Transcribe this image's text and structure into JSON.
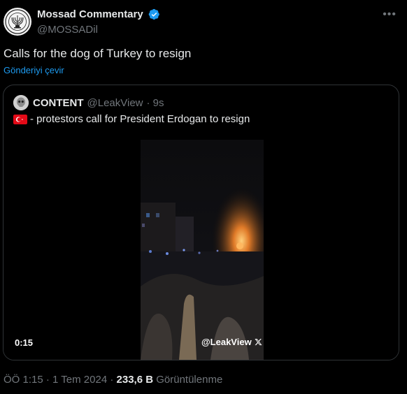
{
  "tweet": {
    "display_name": "Mossad Commentary",
    "handle": "@MOSSADil",
    "more_icon": "•••",
    "text": "Calls for the dog of Turkey to resign",
    "translate_link": "Gönderiyi çevir",
    "verified_color": "#1d9bf0"
  },
  "quote": {
    "display_name": "CONTENT",
    "handle": "@LeakView",
    "age": "· 9s",
    "flag_icon": "turkey-flag-icon",
    "text": "- protestors call for President Erdogan to resign",
    "video": {
      "duration": "0:15",
      "watermark": "@LeakView"
    }
  },
  "meta": {
    "time": "ÖÖ 1:15",
    "dot1": " · ",
    "date": "1 Tem 2024",
    "dot2": " · ",
    "views_count": "233,6 B",
    "views_label": " Görüntülenme"
  }
}
